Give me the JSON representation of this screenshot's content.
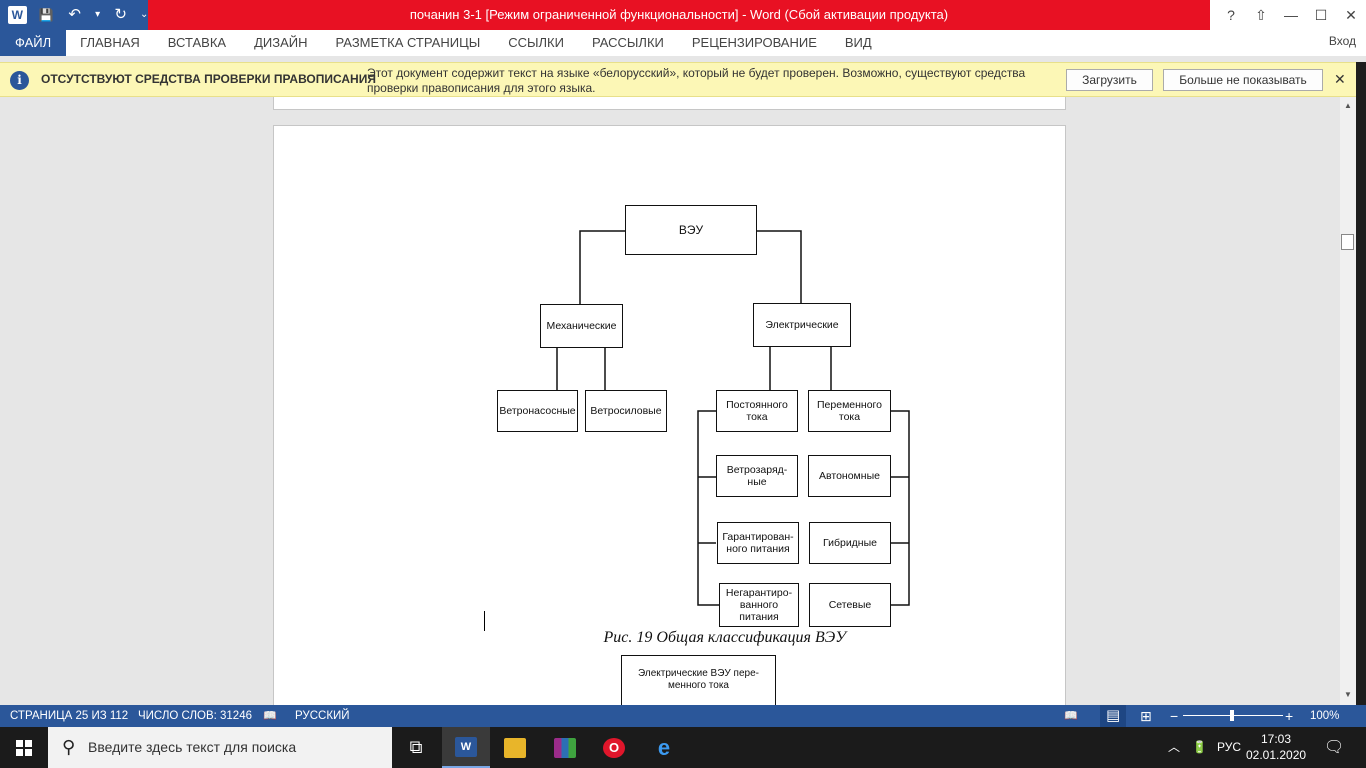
{
  "titlebar": {
    "title": "почанин 3-1 [Режим ограниченной функциональности] -  Word (Сбой активации продукта)",
    "help": "?",
    "ribbon_display": "⇧",
    "minimize": "—",
    "maximize": "☐",
    "close": "✕",
    "app_letter": "W",
    "save_glyph": "💾",
    "undo_glyph": "↶",
    "undo_dropdown": "▾",
    "redo_glyph": "↻",
    "qat_customize": "⌄"
  },
  "ribbon": {
    "tabs": [
      {
        "label": "ФАЙЛ"
      },
      {
        "label": "ГЛАВНАЯ"
      },
      {
        "label": "ВСТАВКА"
      },
      {
        "label": "ДИЗАЙН"
      },
      {
        "label": "РАЗМЕТКА СТРАНИЦЫ"
      },
      {
        "label": "ССЫЛКИ"
      },
      {
        "label": "РАССЫЛКИ"
      },
      {
        "label": "РЕЦЕНЗИРОВАНИЕ"
      },
      {
        "label": "ВИД"
      }
    ],
    "signin": "Вход"
  },
  "messagebar": {
    "icon_glyph": "i",
    "title": "ОТСУТСТВУЮТ СРЕДСТВА ПРОВЕРКИ ПРАВОПИСАНИЯ",
    "text": "Этот документ содержит текст на языке «белорусский», который не будет проверен. Возможно, существуют средства проверки правописания для этого языка.",
    "download_label": "Загрузить",
    "dont_show_label": "Больше не показывать",
    "close_glyph": "✕"
  },
  "diagram": {
    "root": "ВЭУ",
    "mechanical": "Механические",
    "electrical": "Электрические",
    "wind_pump": "Ветронасосные",
    "wind_power": "Ветросиловые",
    "dc": "Постоянного тока",
    "ac": "Переменного тока",
    "charging": "Ветрозаряд-ные",
    "autonomous": "Автономные",
    "guaranteed": "Гарантирован-ного питания",
    "hybrid": "Гибридные",
    "non_guaranteed": "Негарантиро-ванного питания",
    "grid": "Сетевые",
    "caption": "Рис. 19 Общая классификация ВЭУ",
    "next_box": "Электрические ВЭУ пере-менного тока"
  },
  "statusbar": {
    "page": "СТРАНИЦА 25 ИЗ 112",
    "words": "ЧИСЛО СЛОВ: 31246",
    "proofing_glyph": "📖",
    "language": "РУССКИЙ",
    "zoom_minus": "−",
    "zoom_plus": "+",
    "zoom": "100%",
    "view_read_glyph": "📖",
    "view_print_glyph": "▤",
    "view_web_glyph": "⊞"
  },
  "taskbar": {
    "search_icon_glyph": "⚲",
    "search_placeholder": "Введите здесь текст для поиска",
    "taskview_glyph": "⧉",
    "word_letter": "W",
    "opera_letter": "O",
    "edge_letter": "e",
    "tray_chevron": "︿",
    "tray_network": "🔋",
    "language": "РУС",
    "time": "17:03",
    "date": "02.01.2020",
    "notifications_glyph": "🗨"
  },
  "scrollbar": {
    "up_glyph": "▲",
    "down_glyph": "▼"
  }
}
